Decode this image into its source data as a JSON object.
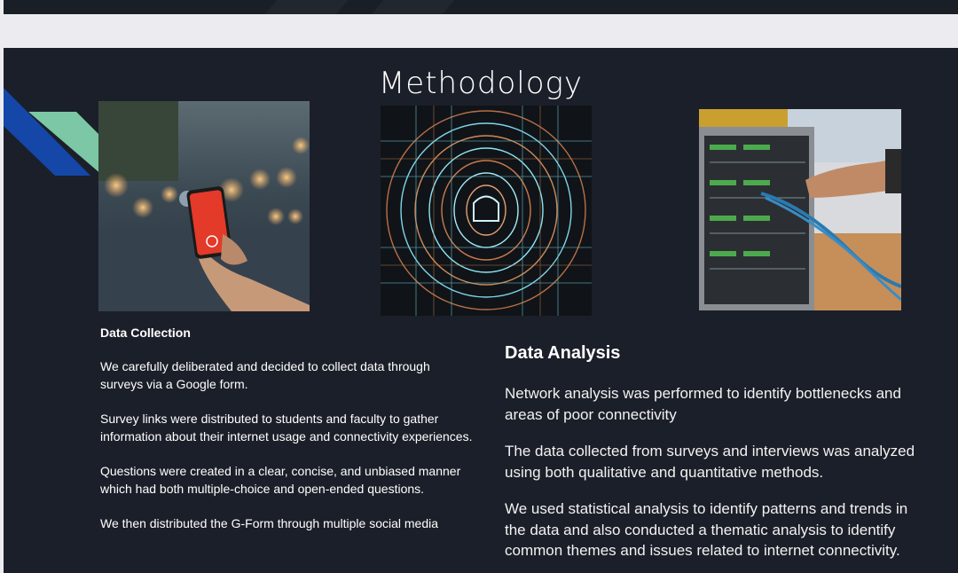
{
  "slide": {
    "title": "Methodology",
    "images": [
      {
        "name": "hand holding red smartphone with bokeh street background"
      },
      {
        "name": "glowing circular digital circuit pattern"
      },
      {
        "name": "hand plugging network cables into server rack"
      }
    ],
    "data_collection": {
      "heading": "Data Collection",
      "paragraphs": [
        "We carefully deliberated and decided to collect data through surveys via a Google form.",
        "Survey links were distributed to students and faculty to gather information about their internet usage and connectivity experiences.",
        "Questions were created in a clear, concise, and unbiased manner which had both multiple-choice and open-ended questions.",
        "We then distributed the G-Form through multiple social media"
      ]
    },
    "data_analysis": {
      "heading": "Data Analysis",
      "paragraphs": [
        "Network analysis was performed to identify bottlenecks and areas of poor connectivity",
        "The data collected from surveys and interviews was analyzed using both qualitative and quantitative methods.",
        "We used statistical analysis to identify patterns and trends in the data and also conducted a thematic analysis to identify common themes and issues related to internet connectivity."
      ]
    }
  }
}
